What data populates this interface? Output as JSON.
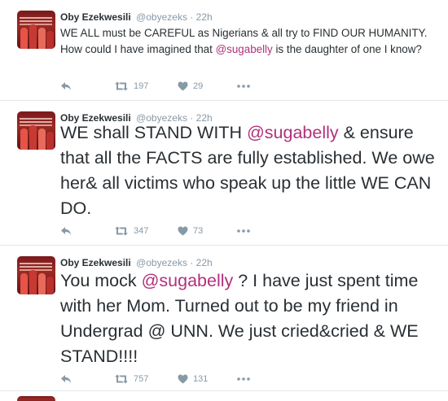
{
  "tweets": [
    {
      "name": "Oby Ezekwesili",
      "handle": "@obyezeks",
      "time": "22h",
      "text_parts": [
        "WE ALL must be CAREFUL as Nigerians & all try to FIND OUR HUMANITY. How could I have imagined that ",
        "@sugabelly",
        " is the daughter of one I know?"
      ],
      "retweets": "197",
      "likes": "29"
    },
    {
      "name": "Oby Ezekwesili",
      "handle": "@obyezeks",
      "time": "22h",
      "text_parts": [
        "WE shall STAND WITH ",
        "@sugabelly",
        " & ensure that all the FACTS are fully established. We owe her& all victims who speak up the little WE CAN DO."
      ],
      "retweets": "347",
      "likes": "73"
    },
    {
      "name": "Oby Ezekwesili",
      "handle": "@obyezeks",
      "time": "22h",
      "text_parts": [
        "You mock ",
        "@sugabelly",
        " ? I have just spent time with her Mom. Turned out to be my friend in Undergrad @ UNN. We just cried&cried & WE STAND!!!!"
      ],
      "retweets": "757",
      "likes": "131"
    }
  ],
  "icons": {
    "reply": "reply-icon",
    "retweet": "retweet-icon",
    "like": "heart-icon",
    "more": "more-dots-icon"
  },
  "colors": {
    "mention": "#b0317b",
    "meta": "#8899a6",
    "text": "#292f33",
    "divider": "#e1e8ed"
  }
}
